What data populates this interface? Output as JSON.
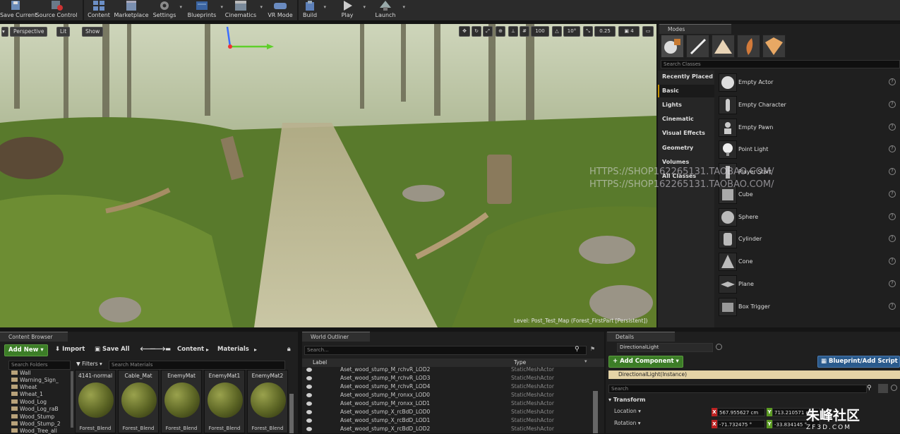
{
  "toolbar": {
    "items": [
      {
        "label": "Save Current",
        "icon": "floppy-disk-icon"
      },
      {
        "label": "Source Control",
        "icon": "source-control-icon"
      },
      {
        "label": "Content",
        "icon": "content-icon"
      },
      {
        "label": "Marketplace",
        "icon": "marketplace-icon"
      },
      {
        "label": "Settings",
        "icon": "gear-icon"
      },
      {
        "label": "Blueprints",
        "icon": "blueprint-icon"
      },
      {
        "label": "Cinematics",
        "icon": "clapperboard-icon"
      },
      {
        "label": "VR Mode",
        "icon": "vr-headset-icon"
      },
      {
        "label": "Build",
        "icon": "build-icon"
      },
      {
        "label": "Play",
        "icon": "play-icon"
      },
      {
        "label": "Launch",
        "icon": "launch-icon"
      }
    ]
  },
  "viewport": {
    "perspective_label": "Perspective",
    "lit_label": "Lit",
    "show_label": "Show",
    "grid_snap": "100",
    "rot_snap": "10°",
    "scale_snap": "0.25",
    "camera_speed": "4",
    "level_text": "Level: Post_Test_Map (Forest_FirstPart [Persistent])"
  },
  "modes": {
    "tab_label": "Modes",
    "search_placeholder": "Search Classes",
    "categories": [
      "Recently Placed",
      "Basic",
      "Lights",
      "Cinematic",
      "Visual Effects",
      "Geometry",
      "Volumes",
      "All Classes"
    ],
    "active_category": "Basic",
    "items": [
      "Empty Actor",
      "Empty Character",
      "Empty Pawn",
      "Point Light",
      "Player Start",
      "Cube",
      "Sphere",
      "Cylinder",
      "Cone",
      "Plane",
      "Box Trigger"
    ]
  },
  "content_browser": {
    "tab_label": "Content Browser",
    "add_new": "Add New",
    "import": "Import",
    "save_all": "Save All",
    "path": [
      "Content",
      "Materials"
    ],
    "search_folders_placeholder": "Search Folders",
    "filters_label": "Filters",
    "search_materials_placeholder": "Search Materials",
    "folders": [
      "Wall",
      "Warning_Sign_",
      "Wheat",
      "Wheat_1",
      "Wood_Log",
      "Wood_Log_raB",
      "Wood_Stump",
      "Wood_Stump_2",
      "Wood_Tree_all"
    ],
    "assets": [
      {
        "name": "4141-normal",
        "sub": "Forest_Blend"
      },
      {
        "name": "Cable_Mat",
        "sub": "Forest_Blend"
      },
      {
        "name": "EnemyMat",
        "sub": "Forest_Blend"
      },
      {
        "name": "EnemyMat1",
        "sub": "Forest_Blend"
      },
      {
        "name": "EnemyMat2",
        "sub": "Forest_Blend"
      }
    ]
  },
  "world_outliner": {
    "tab_label": "World Outliner",
    "search_placeholder": "Search...",
    "col_label": "Label",
    "col_type": "Type",
    "rows": [
      {
        "label": "Aset_wood_stump_M_rchvR_LOD2",
        "type": "StaticMeshActor"
      },
      {
        "label": "Aset_wood_stump_M_rchvR_LOD3",
        "type": "StaticMeshActor"
      },
      {
        "label": "Aset_wood_stump_M_rchvR_LOD4",
        "type": "StaticMeshActor"
      },
      {
        "label": "Aset_wood_stump_M_ronxx_LOD0",
        "type": "StaticMeshActor"
      },
      {
        "label": "Aset_wood_stump_M_ronxx_LOD1",
        "type": "StaticMeshActor"
      },
      {
        "label": "Aset_wood_stump_X_rcBdD_LOD0",
        "type": "StaticMeshActor"
      },
      {
        "label": "Aset_wood_stump_X_rcBdD_LOD1",
        "type": "StaticMeshActor"
      },
      {
        "label": "Aset_wood_stump_X_rcBdD_LOD2",
        "type": "StaticMeshActor"
      }
    ]
  },
  "details": {
    "tab_label": "Details",
    "name_value": "DirectionalLight",
    "add_component": "+ Add Component",
    "blueprint_button": "Blueprint/Add Script",
    "instance_label": "DirectionalLight(Instance)",
    "search_placeholder": "Search",
    "transform_label": "Transform",
    "location_label": "Location",
    "rotation_label": "Rotation",
    "location": {
      "x": "567.955627 cm",
      "y": "713.210571 cm"
    },
    "rotation": {
      "x": "-71.732475 °",
      "y": "-33.834145 °"
    }
  },
  "watermarks": {
    "line1": "HTTPS://SHOP162265131.TAOBAO.COM/",
    "line2": "HTTPS://SHOP162265131.TAOBAO.COM/",
    "site": "ZF3D.COM",
    "site_cn": "朱峰社区"
  },
  "colors": {
    "accent_green": "#3c7d27",
    "blueprint_blue": "#2a5a8c",
    "panel_bg": "#1f1f1f"
  }
}
